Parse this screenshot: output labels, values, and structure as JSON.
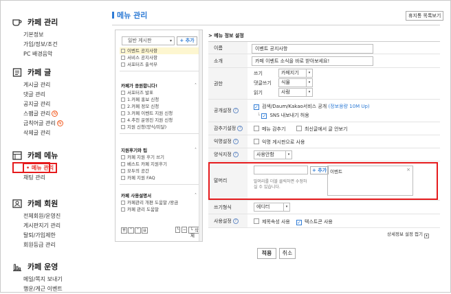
{
  "sidebar": {
    "cafe_manage": {
      "title": "카페 관리",
      "items": [
        "기본정보",
        "가입/정보/조건",
        "PC 배경음악"
      ]
    },
    "cafe_post": {
      "title": "카페 글",
      "items": [
        "게시글 관리",
        "댓글 관리",
        "공지글 관리",
        "스팸글 관리",
        "금칙어글 관리",
        "삭제글 관리"
      ],
      "badge": "N"
    },
    "cafe_menu": {
      "title": "카페 메뉴",
      "items": [
        "메뉴 관리",
        "채팅 관리"
      ]
    },
    "cafe_member": {
      "title": "카페 회원",
      "items": [
        "전체회원/운영진",
        "게시판지기 관리",
        "탈퇴/가입제한",
        "회원등급 관리"
      ]
    },
    "cafe_ops": {
      "title": "카페 운영",
      "items": [
        "메일/쪽지 보내기",
        "행운/게근 이벤트"
      ]
    }
  },
  "header": {
    "title": "메뉴 관리",
    "trash_button": "휴지통 목록보기"
  },
  "menu_panel": {
    "select_label": "일반 게시판",
    "add_button": "+ 추가",
    "group1": [
      "이벤트 공지사항",
      "서비스 공지사항",
      "서포터즈 출석부"
    ],
    "group2_title": "카페가 응원합니다!",
    "group2": [
      "서포터즈 발표",
      "1.카페 홍보 신청",
      "2.카페 정모 신청",
      "3.카페 이벤트 지원 신청",
      "4.추천 운영진 지원 신청",
      "지원 신청(양식/미달)"
    ],
    "group3_title": "지원후기와 팁",
    "group3": [
      "카페 지원 후기 쓰기",
      "베스트 카페 지원후기",
      "모두의 공간",
      "카페 지원 FAQ"
    ],
    "group4_title": "카페 사용설명서",
    "group4": [
      "카페관리 개편 도움말 /왕금",
      "카페 관리 도움말"
    ],
    "delete_button": "└ 삭제"
  },
  "settings": {
    "section_title": "> 메뉴 정보 설정",
    "name_label": "이름",
    "name_value": "이벤트 공지사항",
    "intro_label": "소개",
    "intro_value": "카페 이벤트 소식을 바로 받아보세요!",
    "perm_label": "권한",
    "perm_rows": [
      {
        "label": "쓰기",
        "value": "카페지기"
      },
      {
        "label": "댓글쓰기",
        "value": "식물"
      },
      {
        "label": "읽기",
        "value": "사람"
      }
    ],
    "public_label": "공개설정",
    "public_option1": "검색/Daum/Kakao서비스 공개",
    "public_option1_note": "(정보용량 10M Up)",
    "public_option2": "SNS 내보내기 허용",
    "cohort_label": "감추기설정",
    "cohort_opt1": "메뉴 감추기",
    "cohort_opt2": "최신글에서 글 안보기",
    "anon_label": "익명설정",
    "anon_opt": "익명 게시판으로 사용",
    "style_label": "양식지정",
    "style_value": "사용안함",
    "prefix_label": "말머리",
    "prefix_add": "+ 추가",
    "prefix_hint": "말머리를 더블 클릭하면 수정하실 수 있습니다.",
    "prefix_item": "이벤트",
    "editor_label": "쓰기형식",
    "editor_value": "에디터",
    "use_label": "사용설정",
    "use_opt1": "제목속성 사용",
    "use_opt2": "텍스트콘 사용",
    "detail_link": "상세정보 설정 접기",
    "apply": "적용",
    "cancel": "취소"
  }
}
